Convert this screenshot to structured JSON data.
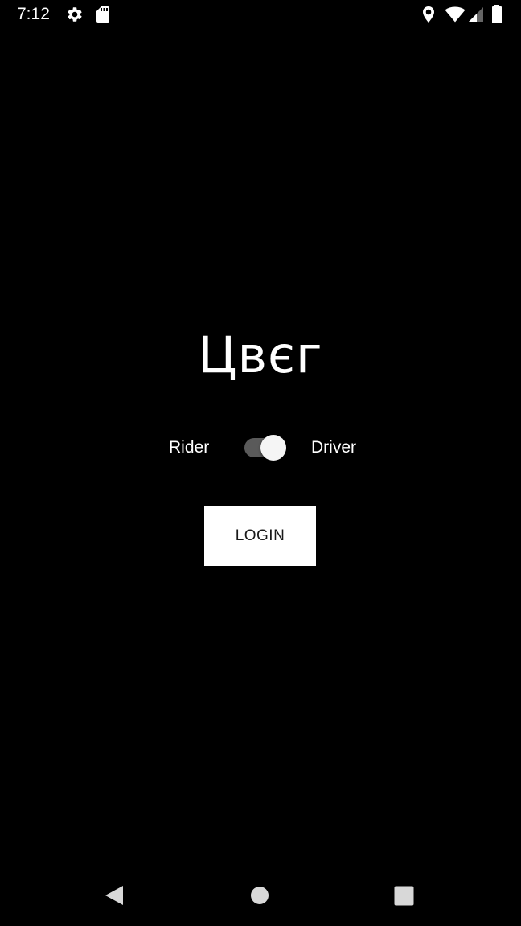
{
  "status_bar": {
    "time": "7:12",
    "icons": [
      "settings-icon",
      "sd-card-icon",
      "location-icon",
      "wifi-icon",
      "signal-icon",
      "battery-icon"
    ]
  },
  "app": {
    "logo_text": "Цвєг"
  },
  "role_toggle": {
    "left_label": "Rider",
    "right_label": "Driver",
    "checked": true
  },
  "login": {
    "label": "LOGIN"
  },
  "navigation": {
    "icons": [
      "back-icon",
      "home-icon",
      "recents-icon"
    ]
  },
  "colors": {
    "background": "#000000",
    "foreground": "#ffffff",
    "switch_track": "#5a5a5a",
    "button_text": "#1a1a1a"
  }
}
